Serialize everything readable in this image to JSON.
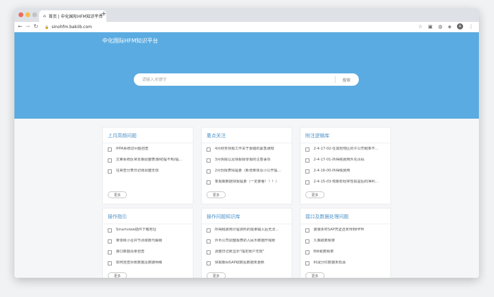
{
  "browser": {
    "tab_title": "首页 | 中化国际HFM知识平台",
    "url": "sinohfm.bakiib.com",
    "profile_initial": "A"
  },
  "site": {
    "brand": "中化国际HFM知识平台",
    "search_placeholder": "请输入关键字",
    "search_button": "搜索"
  },
  "cards": [
    {
      "title": "上月高频问题",
      "items": [
        "IPPA系统访问题自查",
        "文莱系统反常本期调整表/期初提不到/提…",
        "往来查分表日记账调整无效"
      ],
      "more": "更多"
    },
    {
      "title": "重点关注",
      "items": [
        "4月财务快报工作关于报错的紧急通知",
        "3月快报以及快报报零报的注意事项",
        "2月份报表情提要（新增单体及小公开提…",
        "季报期数据快报提要（一定要看！！！）"
      ],
      "more": "更多"
    },
    {
      "title": "附注逻辑库",
      "items": [
        "2-4-17-02-在其他地区的子公司税率不…",
        "2-4-17-01-所得税费用外兑页码",
        "2-4-16-00-所得税费用",
        "2-4-15-03-知期非经常性损益后的净利…"
      ],
      "more": "更多"
    },
    {
      "title": "操作指引",
      "items": [
        "Smartview插件下载地址",
        "单体和小合并节点级数与解锁",
        "接口数据清单自查",
        "如何自查对账数据及数据明细"
      ],
      "more": "更多"
    },
    {
      "title": "操作问题知识库",
      "items": [
        "所得税费用计提资料的报单输入后无法…",
        "外币公司调整报表的人民币数据作报账",
        "调整日记账显示\"指定账户无效\"",
        "快报期间SAP取数后数据未更新"
      ],
      "more": "更多"
    },
    {
      "title": "接口及数据处理问题",
      "items": [
        "要接多时SAP凭证还未传到HFM",
        "久期取数频率",
        "BW取数频率",
        "利润分红数据未抵消"
      ],
      "more": "更多"
    }
  ],
  "colors": {
    "hero": "#5aabe1",
    "card_title": "#4a90c7",
    "light_close": "#ed6a5e",
    "light_min": "#f5bf4f",
    "light_max": "#c3c3c3"
  }
}
